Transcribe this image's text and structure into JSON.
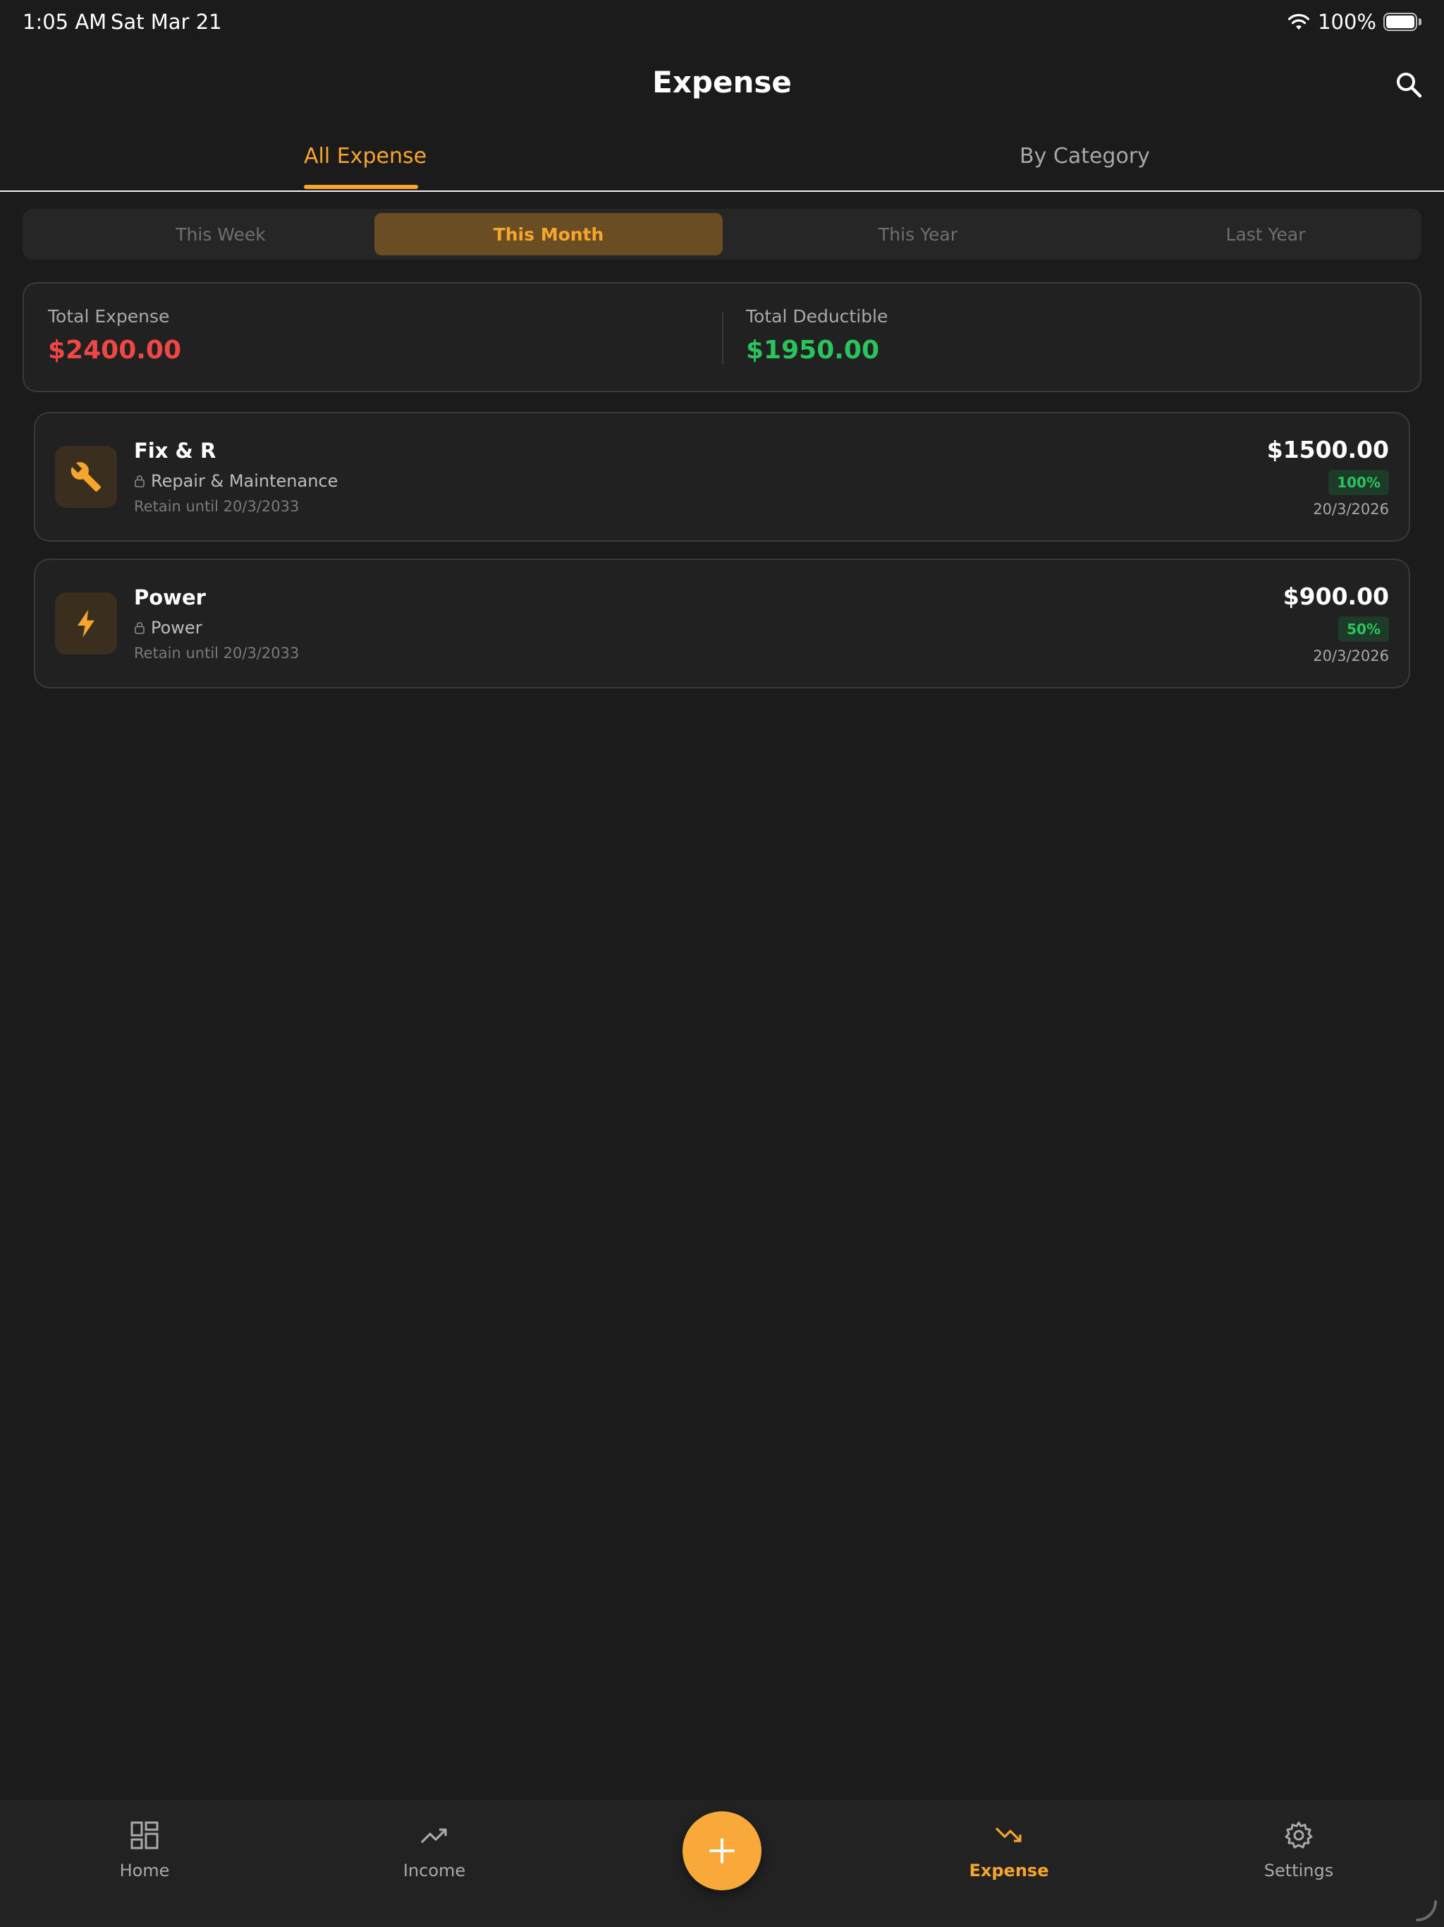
{
  "status_bar": {
    "time": "1:05 AM",
    "date": "Sat Mar 21",
    "battery_percent": "100%",
    "icons": [
      "wifi-icon",
      "battery-icon"
    ]
  },
  "header": {
    "title": "Expense",
    "search_icon": "search-icon"
  },
  "top_tabs": [
    {
      "label": "All Expense",
      "active": true
    },
    {
      "label": "By Category",
      "active": false
    }
  ],
  "periods": [
    {
      "label": "This Week",
      "active": false
    },
    {
      "label": "This Month",
      "active": true
    },
    {
      "label": "This Year",
      "active": false
    },
    {
      "label": "Last Year",
      "active": false
    }
  ],
  "summary": {
    "total_expense_label": "Total Expense",
    "total_expense_value": "$2400.00",
    "total_deductible_label": "Total Deductible",
    "total_deductible_value": "$1950.00"
  },
  "expenses": [
    {
      "title": "Fix & R",
      "category": "Repair & Maintenance",
      "retain": "Retain until 20/3/2033",
      "amount": "$1500.00",
      "deductible": "100%",
      "date": "20/3/2026",
      "icon": "wrench-icon"
    },
    {
      "title": "Power",
      "category": "Power",
      "retain": "Retain until 20/3/2033",
      "amount": "$900.00",
      "deductible": "50%",
      "date": "20/3/2026",
      "icon": "lightning-icon"
    }
  ],
  "bottom_nav": [
    {
      "label": "Home",
      "icon": "dashboard-icon",
      "active": false
    },
    {
      "label": "Income",
      "icon": "trending-up-icon",
      "active": false
    },
    {
      "label": "Expense",
      "icon": "trending-down-icon",
      "active": true
    },
    {
      "label": "Settings",
      "icon": "gear-icon",
      "active": false
    }
  ],
  "fab_icon": "plus-icon",
  "colors": {
    "background": "#1b1b1b",
    "accent": "#f7a62d",
    "expense_red": "#f04646",
    "deductible_green": "#29c45c",
    "card": "#212121"
  }
}
